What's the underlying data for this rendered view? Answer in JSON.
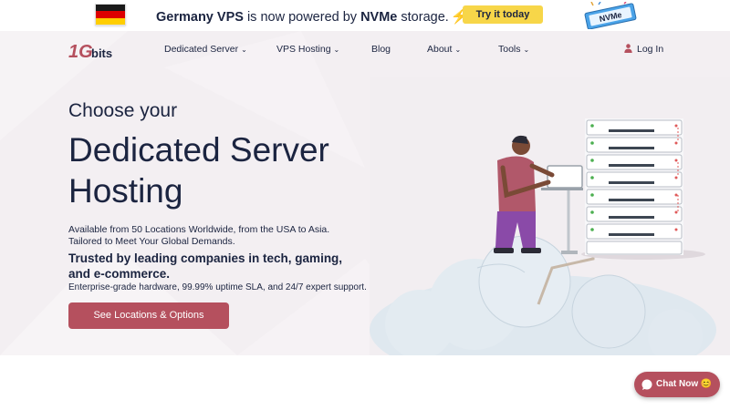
{
  "promo": {
    "text_prefix": "Germany VPS",
    "text_middle": " is now powered by ",
    "text_bold": "NVMe",
    "text_suffix": " storage.",
    "bolt_icon": "⚡",
    "cta_label": "Try it today",
    "badge_text": "NVMe",
    "colors": {
      "cta": "#f7d649"
    }
  },
  "brand": {
    "logo_text": "1Gbits",
    "accent": "#b5505e"
  },
  "nav": {
    "items": [
      {
        "label": "Dedicated Server",
        "has_dropdown": true
      },
      {
        "label": "VPS Hosting",
        "has_dropdown": true
      },
      {
        "label": "Blog",
        "has_dropdown": false
      },
      {
        "label": "About",
        "has_dropdown": true
      },
      {
        "label": "Tools",
        "has_dropdown": true
      }
    ],
    "chevron": "⌄",
    "login_label": "Log In"
  },
  "hero": {
    "eyebrow": "Choose your",
    "title": "Dedicated Server Hosting",
    "description": "Available from 50 Locations Worldwide, from the USA to Asia. Tailored to Meet Your Global Demands.",
    "trusted": "Trusted by leading companies in tech, gaming, and e-commerce.",
    "enterprise": "Enterprise-grade hardware, 99.99% uptime SLA, and 24/7 expert support.",
    "cta_label": "See Locations & Options"
  },
  "chat": {
    "label": "Chat Now",
    "emoji": "😊"
  }
}
